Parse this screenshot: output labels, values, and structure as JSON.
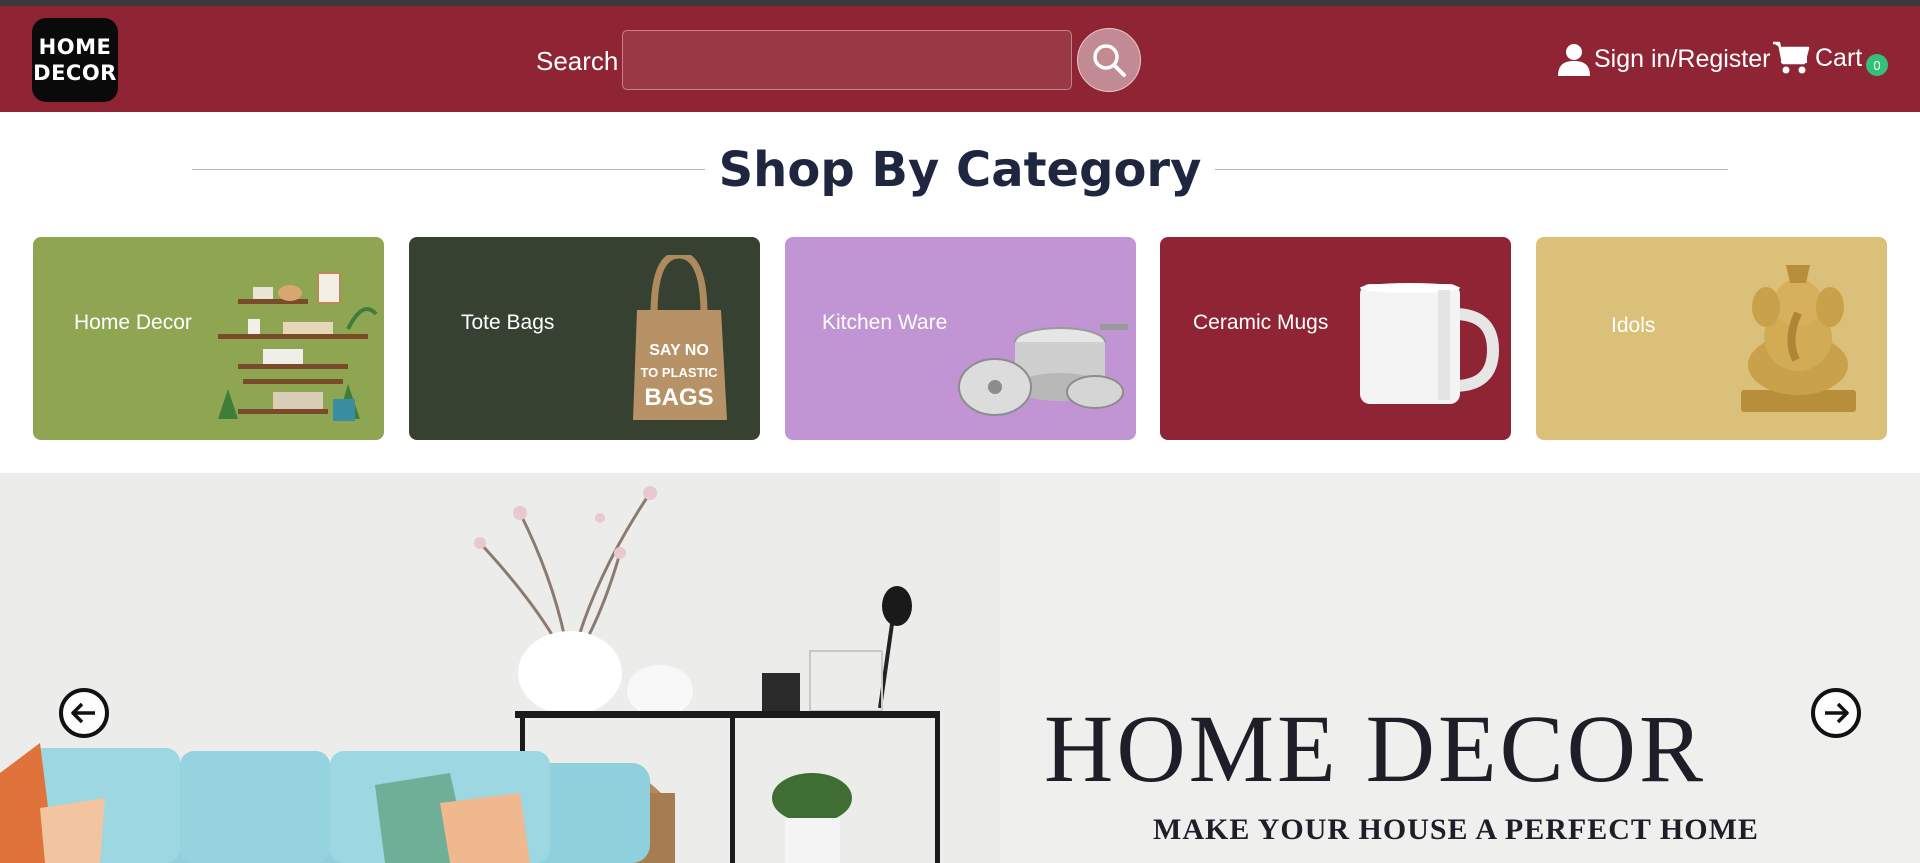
{
  "header": {
    "logo_line1": "HOME",
    "logo_line2": "DECOR",
    "search_label": "Search",
    "search_value": "",
    "signin_label": "Sign in/Register",
    "cart_label": "Cart",
    "cart_count": "0",
    "icons": {
      "search": "search-icon",
      "user": "user-icon",
      "cart": "cart-icon"
    }
  },
  "categories_section": {
    "title": "Shop By Category",
    "items": [
      {
        "label": "Home Decor",
        "color": "#8ea651",
        "icon": "wall-shelves-icon"
      },
      {
        "label": "Tote Bags",
        "color": "#374132",
        "icon": "tote-bag-icon",
        "bag_text": [
          "SAY NO",
          "TO PLASTIC",
          "BAGS"
        ]
      },
      {
        "label": "Kitchen Ware",
        "color": "#c194d3",
        "icon": "cookware-icon"
      },
      {
        "label": "Ceramic Mugs",
        "color": "#8f2434",
        "icon": "mug-icon"
      },
      {
        "label": "Idols",
        "color": "#dac078",
        "icon": "ganesha-idol-icon"
      }
    ]
  },
  "banner": {
    "title": "HOME DECOR",
    "subtitle": "MAKE YOUR HOUSE A PERFECT HOME",
    "prev_icon": "arrow-left-icon",
    "next_icon": "arrow-right-icon"
  },
  "colors": {
    "header_bg": "#8f2434",
    "badge": "#35c07a",
    "banner_bg": "#efefed"
  }
}
